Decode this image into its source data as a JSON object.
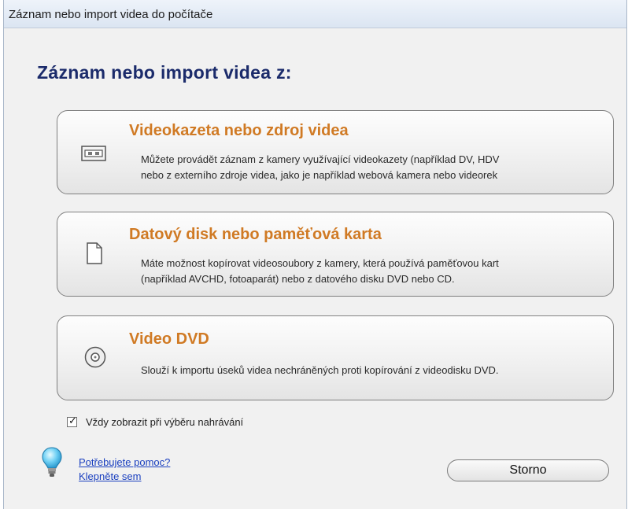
{
  "window": {
    "title": "Záznam nebo import videa do počítače"
  },
  "heading": "Záznam nebo import videa z:",
  "options": [
    {
      "title": "Videokazeta nebo zdroj videa",
      "desc_line1": "Můžete provádět záznam z kamery využívající videokazety (například DV, HDV",
      "desc_line2": "nebo z externího zdroje videa, jako je například webová kamera nebo videorek",
      "icon": "videotape-icon"
    },
    {
      "title": "Datový disk nebo paměťová karta",
      "desc_line1": "Máte možnost kopírovat videosoubory z kamery, která používá paměťovou kart",
      "desc_line2": "(například AVCHD, fotoaparát) nebo z datového disku DVD nebo CD.",
      "icon": "memory-card-icon"
    },
    {
      "title": "Video DVD",
      "desc_line1": "Slouží k importu úseků videa nechráněných proti kopírování z videodisku DVD.",
      "icon": "dvd-disc-icon"
    }
  ],
  "always_show": {
    "label": "Vždy zobrazit při výběru nahrávání",
    "checked": true,
    "mark": "✓"
  },
  "help": {
    "line1": "Potřebujete pomoc?",
    "line2": "Klepněte sem",
    "icon": "lightbulb-icon"
  },
  "cancel_button": "Storno",
  "colors": {
    "heading": "#1b2b6b",
    "option_title": "#d07a24",
    "link": "#1a3fbf"
  }
}
